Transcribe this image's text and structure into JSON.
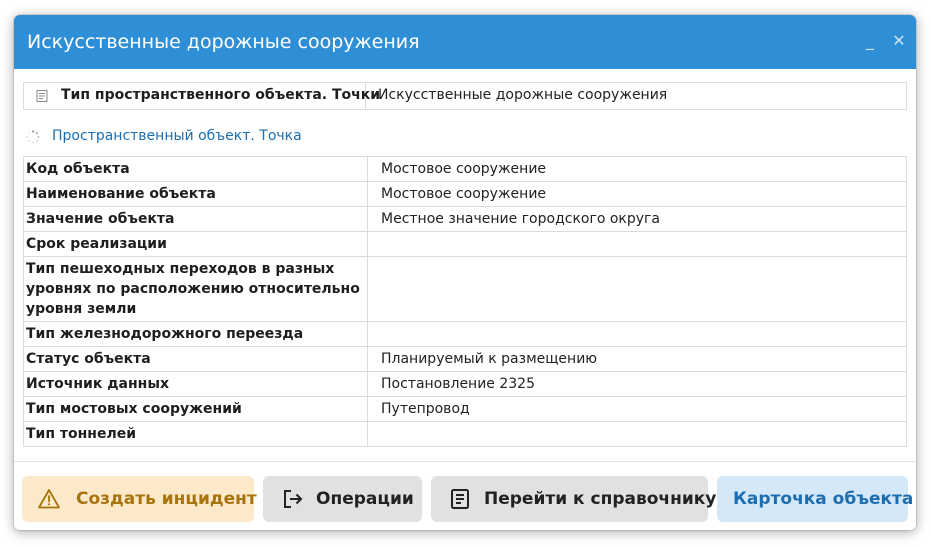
{
  "window": {
    "title": "Искусственные дорожные сооружения",
    "minimize_glyph": "_",
    "close_glyph": "✕"
  },
  "header_row": {
    "icon": "document-icon",
    "label": "Тип пространственного объекта. Точки",
    "value": "Искусственные дорожные сооружения"
  },
  "spatial_link": {
    "icon": "loading-spinner-icon",
    "label": "Пространственный объект. Точка"
  },
  "attributes": [
    {
      "key": "Код объекта",
      "value": "Мостовое сооружение"
    },
    {
      "key": "Наименование объекта",
      "value": "Мостовое сооружение"
    },
    {
      "key": "Значение объекта",
      "value": "Местное значение городского округа"
    },
    {
      "key": "Срок реализации",
      "value": ""
    },
    {
      "key": "Тип пешеходных переходов в разных уровнях по расположению относительно уровня земли",
      "value": ""
    },
    {
      "key": "Тип железнодорожного переезда",
      "value": ""
    },
    {
      "key": "Статус объекта",
      "value": "Планируемый к размещению"
    },
    {
      "key": "Источник данных",
      "value": "Постановление 2325"
    },
    {
      "key": "Тип мостовых сооружений",
      "value": "Путепровод"
    },
    {
      "key": "Тип тоннелей",
      "value": ""
    }
  ],
  "footer": {
    "create_incident": {
      "label": "Создать инцидент",
      "icon": "warning-triangle-icon"
    },
    "operations": {
      "label": "Операции",
      "icon": "exit-arrow-icon"
    },
    "go_to_reference": {
      "label": "Перейти к справочнику",
      "icon": "document-list-icon"
    },
    "object_card": {
      "label": "Карточка объекта"
    }
  },
  "colors": {
    "titlebar": "#2f8fd6",
    "link": "#1a6fb3",
    "incident_bg": "#fbe9c9",
    "incident_fg": "#a8740f",
    "neutral_btn_bg": "#e1e1e1",
    "card_btn_bg": "#d5e8f8",
    "card_btn_fg": "#1d6eb0"
  }
}
